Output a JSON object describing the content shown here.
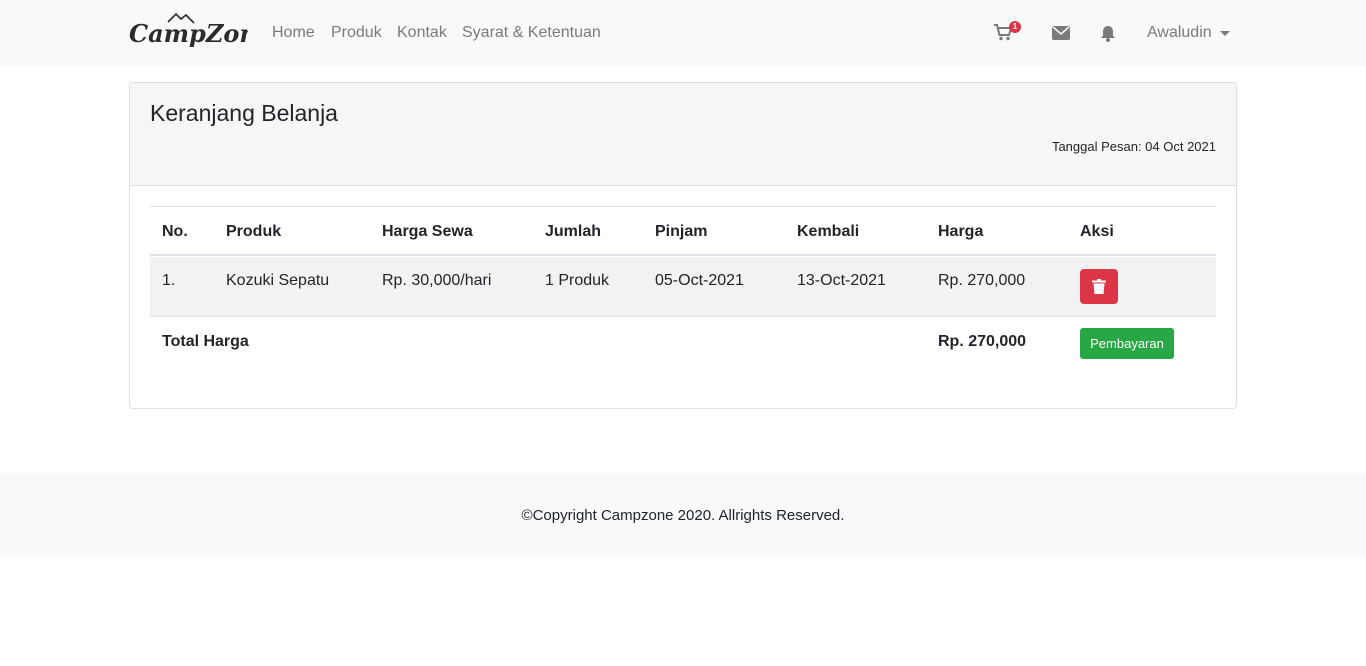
{
  "brand": {
    "logo_text": "CampZone"
  },
  "nav": {
    "links": [
      "Home",
      "Produk",
      "Kontak",
      "Syarat & Ketentuan"
    ],
    "cart_count": "1",
    "user_name": "Awaludin",
    "icons": [
      "cart-icon",
      "envelope-icon",
      "bell-icon",
      "caret-down-icon"
    ]
  },
  "card": {
    "title": "Keranjang Belanja",
    "order_date": "Tanggal Pesan: 04 Oct 2021"
  },
  "table": {
    "headers": [
      "No.",
      "Produk",
      "Harga Sewa",
      "Jumlah",
      "Pinjam",
      "Kembali",
      "Harga",
      "Aksi"
    ],
    "rows": [
      [
        "1.",
        "Kozuki Sepatu",
        "Rp. 30,000/hari",
        "1 Produk",
        "05-Oct-2021",
        "13-Oct-2021",
        "Rp. 270,000"
      ]
    ],
    "total_label": "Total Harga",
    "total_value": "Rp. 270,000",
    "pay_button": "Pembayaran",
    "delete_icon": "trash-icon"
  },
  "footer": {
    "copyright": "©Copyright Campzone 2020. Allrights Reserved."
  },
  "colors": {
    "danger": "#dc3545",
    "success": "#28a745",
    "navbar_bg": "#f8f9fa"
  }
}
